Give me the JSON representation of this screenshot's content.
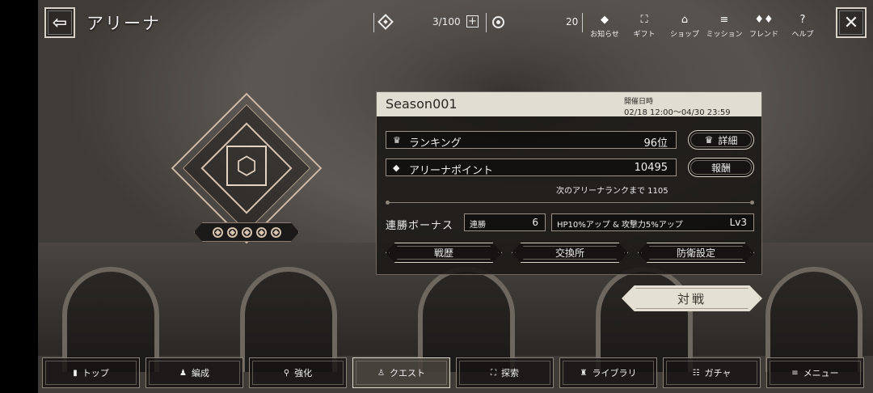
{
  "header": {
    "title": "アリーナ",
    "stamina": "3/100",
    "coins": "20"
  },
  "top_menu": [
    {
      "label": "お知らせ",
      "icon": "notice-icon"
    },
    {
      "label": "ギフト",
      "icon": "gift-icon"
    },
    {
      "label": "ショップ",
      "icon": "shop-icon"
    },
    {
      "label": "ミッション",
      "icon": "mission-icon"
    },
    {
      "label": "フレンド",
      "icon": "friend-icon"
    },
    {
      "label": "ヘルプ",
      "icon": "help-icon"
    }
  ],
  "season": {
    "name": "Season001",
    "period_label": "開催日時",
    "period": "02/18 12:00～04/30 23:59"
  },
  "ranking": {
    "label": "ランキング",
    "value": "96位",
    "button": "詳細"
  },
  "arena_points": {
    "label": "アリーナポイント",
    "value": "10495",
    "button": "報酬"
  },
  "next_rank": "次のアリーナランクまで 1105",
  "bonus": {
    "label": "連勝ボーナス",
    "streak_label": "連勝",
    "streak_value": "6",
    "effect": "HP10%アップ & 攻撃力5%アップ",
    "level": "Lv3"
  },
  "actions": {
    "history": "戦歴",
    "exchange": "交換所",
    "defense": "防衛設定"
  },
  "battle_button": "対戦",
  "bottom_nav": [
    {
      "label": "トップ",
      "icon": "home-icon",
      "active": false
    },
    {
      "label": "編成",
      "icon": "party-icon",
      "active": false
    },
    {
      "label": "強化",
      "icon": "enhance-icon",
      "active": false
    },
    {
      "label": "クエスト",
      "icon": "quest-icon",
      "active": true
    },
    {
      "label": "探索",
      "icon": "explore-icon",
      "active": false
    },
    {
      "label": "ライブラリ",
      "icon": "library-icon",
      "active": false
    },
    {
      "label": "ガチャ",
      "icon": "gacha-icon",
      "active": false
    },
    {
      "label": "メニュー",
      "icon": "menu-icon",
      "active": false
    }
  ]
}
